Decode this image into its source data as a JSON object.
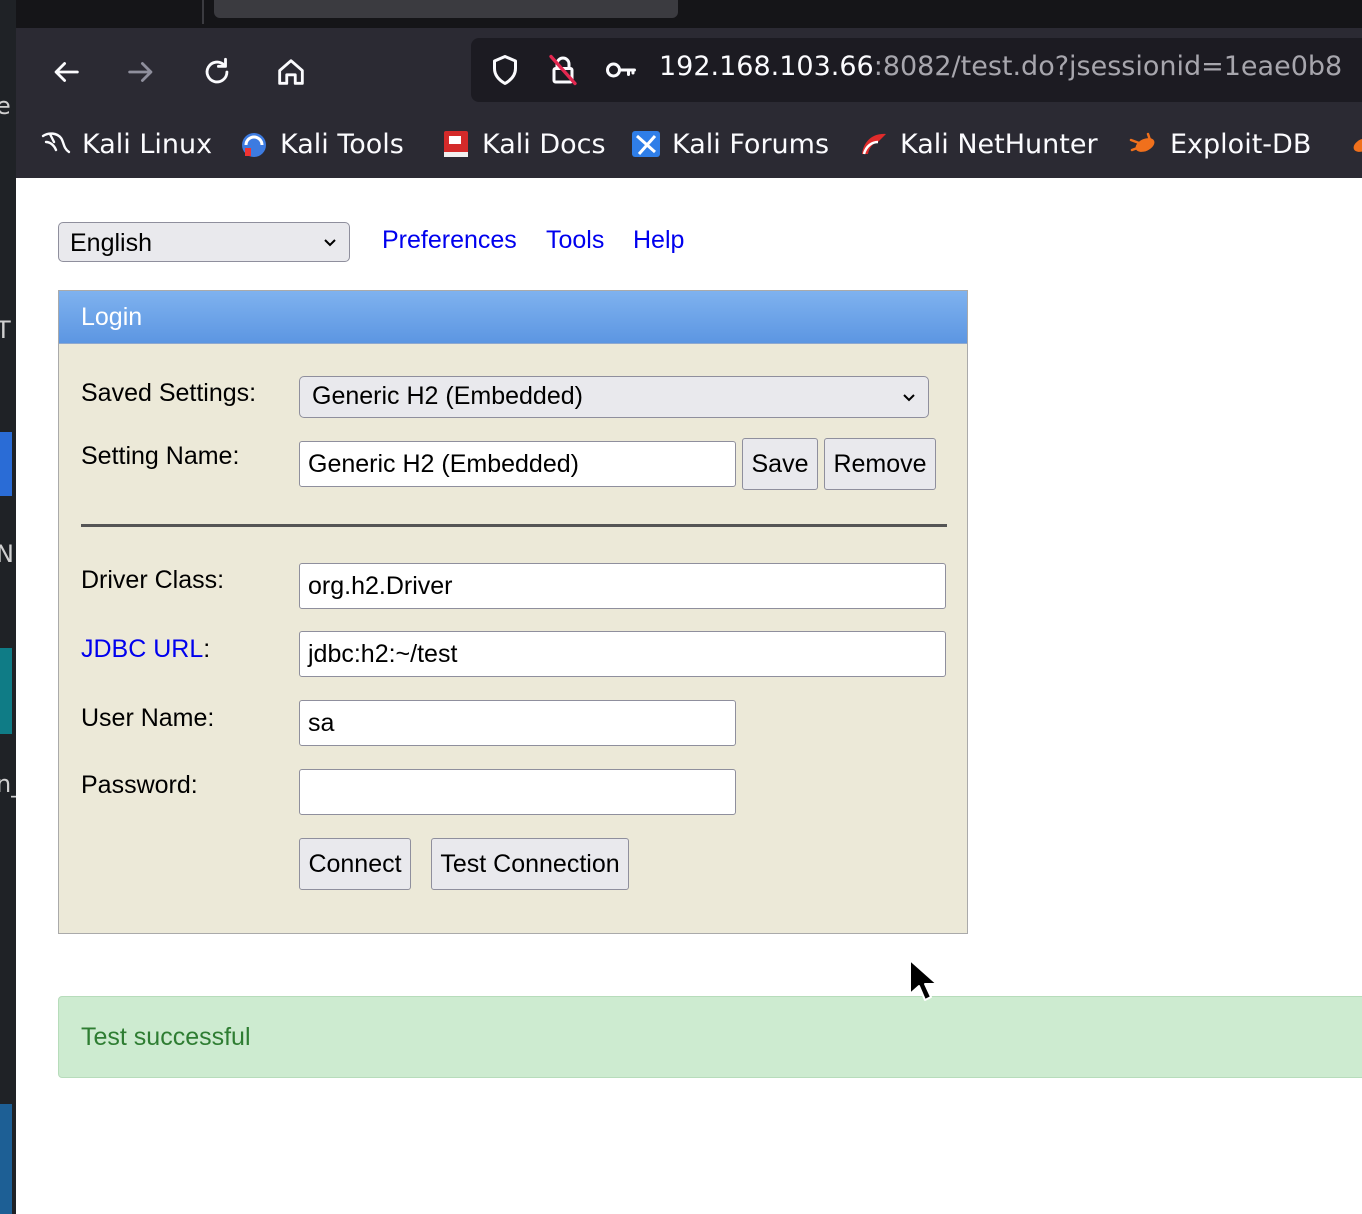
{
  "browser": {
    "url_host": "192.168.103.66",
    "url_rest": ":8082/test.do?jsessionid=1eae0b8",
    "bookmarks": [
      {
        "label": "Kali Linux",
        "icon": "kali-dragon-icon"
      },
      {
        "label": "Kali Tools",
        "icon": "kali-tools-icon"
      },
      {
        "label": "Kali Docs",
        "icon": "kali-docs-icon"
      },
      {
        "label": "Kali Forums",
        "icon": "kali-forums-icon"
      },
      {
        "label": "Kali NetHunter",
        "icon": "kali-nethunter-icon"
      },
      {
        "label": "Exploit-DB",
        "icon": "exploit-db-icon"
      }
    ]
  },
  "desktop": {
    "fragments": [
      "e",
      "T",
      "N",
      "n_"
    ]
  },
  "toolbar": {
    "language": "English",
    "links": [
      "Preferences",
      "Tools",
      "Help"
    ]
  },
  "login": {
    "title": "Login",
    "saved_settings_label": "Saved Settings:",
    "saved_settings_value": "Generic H2 (Embedded)",
    "setting_name_label": "Setting Name:",
    "setting_name_value": "Generic H2 (Embedded)",
    "save_label": "Save",
    "remove_label": "Remove",
    "driver_class_label": "Driver Class:",
    "driver_class_value": "org.h2.Driver",
    "jdbc_url_label": "JDBC URL",
    "jdbc_url_colon": ":",
    "jdbc_url_value": "jdbc:h2:~/test",
    "user_name_label": "User Name:",
    "user_name_value": "sa",
    "password_label": "Password:",
    "password_value": "",
    "connect_label": "Connect",
    "test_connection_label": "Test Connection"
  },
  "result": {
    "message": "Test successful"
  },
  "colors": {
    "header_blue": "#6ea3ea",
    "panel_bg": "#ece9d8",
    "success_bg": "#cdebd0",
    "success_text": "#2e7d32",
    "link": "#0000ee"
  }
}
